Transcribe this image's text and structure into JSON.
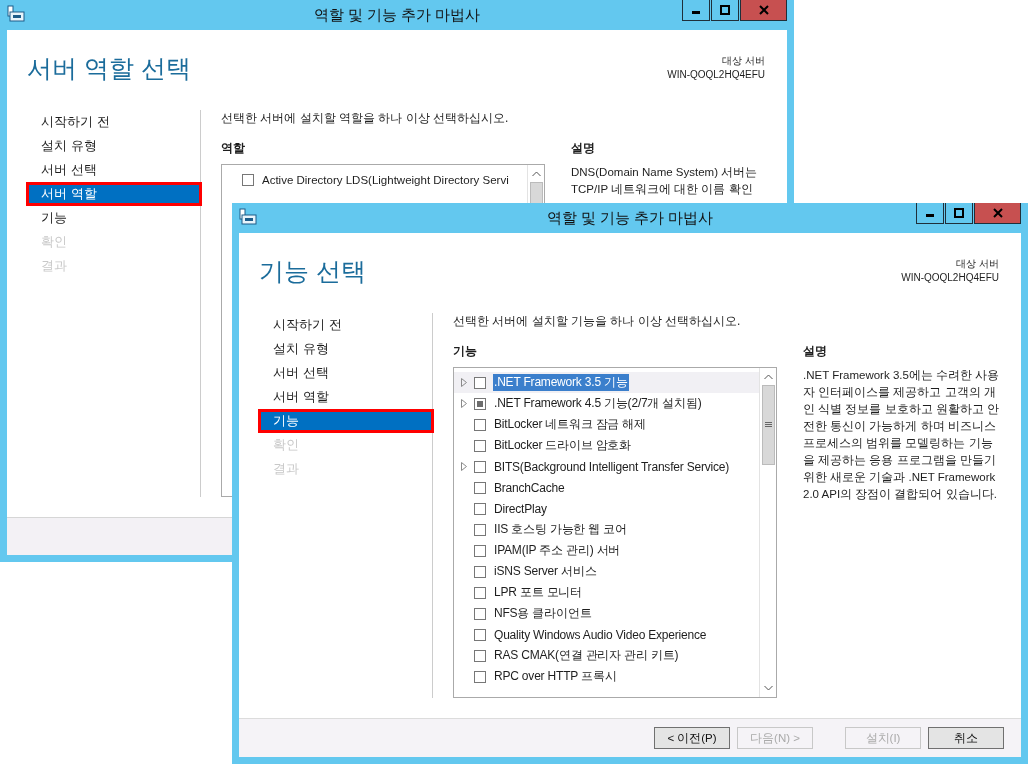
{
  "windows": [
    {
      "title": "역할 및 기능 추가 마법사",
      "heading": "서버 역할 선택",
      "target_label": "대상 서버",
      "target_value": "WIN-QOQL2HQ4EFU",
      "nav": [
        {
          "label": "시작하기 전",
          "selected": false,
          "disabled": false
        },
        {
          "label": "설치 유형",
          "selected": false,
          "disabled": false
        },
        {
          "label": "서버 선택",
          "selected": false,
          "disabled": false
        },
        {
          "label": "서버 역할",
          "selected": true,
          "disabled": false
        },
        {
          "label": "기능",
          "selected": false,
          "disabled": false
        },
        {
          "label": "확인",
          "selected": false,
          "disabled": true
        },
        {
          "label": "결과",
          "selected": false,
          "disabled": true
        }
      ],
      "instruction": "선택한 서버에 설치할 역할을 하나 이상 선택하십시오.",
      "list_heading": "역할",
      "items": [
        {
          "label": "Active Directory LDS(Lightweight Directory Servi",
          "expandable": false,
          "checked": false,
          "indeterminate": false,
          "selected": false
        }
      ],
      "description_heading": "설명",
      "description": "DNS(Domain Name System) 서버는\nTCP/IP 네트워크에 대한 이름 확인"
    },
    {
      "title": "역할 및 기능 추가 마법사",
      "heading": "기능 선택",
      "target_label": "대상 서버",
      "target_value": "WIN-QOQL2HQ4EFU",
      "nav": [
        {
          "label": "시작하기 전",
          "selected": false,
          "disabled": false
        },
        {
          "label": "설치 유형",
          "selected": false,
          "disabled": false
        },
        {
          "label": "서버 선택",
          "selected": false,
          "disabled": false
        },
        {
          "label": "서버 역할",
          "selected": false,
          "disabled": false
        },
        {
          "label": "기능",
          "selected": true,
          "disabled": false
        },
        {
          "label": "확인",
          "selected": false,
          "disabled": true
        },
        {
          "label": "결과",
          "selected": false,
          "disabled": true
        }
      ],
      "instruction": "선택한 서버에 설치할 기능을 하나 이상 선택하십시오.",
      "list_heading": "기능",
      "items": [
        {
          "label": ".NET Framework 3.5 기능",
          "expandable": true,
          "checked": false,
          "indeterminate": false,
          "selected": true
        },
        {
          "label": ".NET Framework 4.5 기능(2/7개 설치됨)",
          "expandable": true,
          "checked": false,
          "indeterminate": true,
          "selected": false
        },
        {
          "label": "BitLocker 네트워크 잠금 해제",
          "expandable": false,
          "checked": false,
          "indeterminate": false,
          "selected": false
        },
        {
          "label": "BitLocker 드라이브 암호화",
          "expandable": false,
          "checked": false,
          "indeterminate": false,
          "selected": false
        },
        {
          "label": "BITS(Background Intelligent Transfer Service)",
          "expandable": true,
          "checked": false,
          "indeterminate": false,
          "selected": false
        },
        {
          "label": "BranchCache",
          "expandable": false,
          "checked": false,
          "indeterminate": false,
          "selected": false
        },
        {
          "label": "DirectPlay",
          "expandable": false,
          "checked": false,
          "indeterminate": false,
          "selected": false
        },
        {
          "label": "IIS 호스팅 가능한 웹 코어",
          "expandable": false,
          "checked": false,
          "indeterminate": false,
          "selected": false
        },
        {
          "label": "IPAM(IP 주소 관리) 서버",
          "expandable": false,
          "checked": false,
          "indeterminate": false,
          "selected": false
        },
        {
          "label": "iSNS Server 서비스",
          "expandable": false,
          "checked": false,
          "indeterminate": false,
          "selected": false
        },
        {
          "label": "LPR 포트 모니터",
          "expandable": false,
          "checked": false,
          "indeterminate": false,
          "selected": false
        },
        {
          "label": "NFS용 클라이언트",
          "expandable": false,
          "checked": false,
          "indeterminate": false,
          "selected": false
        },
        {
          "label": "Quality Windows Audio Video Experience",
          "expandable": false,
          "checked": false,
          "indeterminate": false,
          "selected": false
        },
        {
          "label": "RAS CMAK(연결 관리자 관리 키트)",
          "expandable": false,
          "checked": false,
          "indeterminate": false,
          "selected": false
        },
        {
          "label": "RPC over HTTP 프록시",
          "expandable": false,
          "checked": false,
          "indeterminate": false,
          "selected": false
        }
      ],
      "description_heading": "설명",
      "description": ".NET Framework 3.5에는 수려한 사용자 인터페이스를 제공하고 고객의 개인 식별 정보를 보호하고 원활하고 안전한 통신이 가능하게 하며 비즈니스 프로세스의 범위를 모델링하는 기능을 제공하는 응용 프로그램을 만들기 위한 새로운 기술과 .NET Framework 2.0 API의 장점이 결합되어 있습니다.",
      "buttons": [
        {
          "label": "< 이전(P)",
          "disabled": false
        },
        {
          "label": "다음(N) >",
          "disabled": true
        },
        {
          "label": "설치(I)",
          "disabled": true
        },
        {
          "label": "취소",
          "disabled": false
        }
      ]
    }
  ]
}
